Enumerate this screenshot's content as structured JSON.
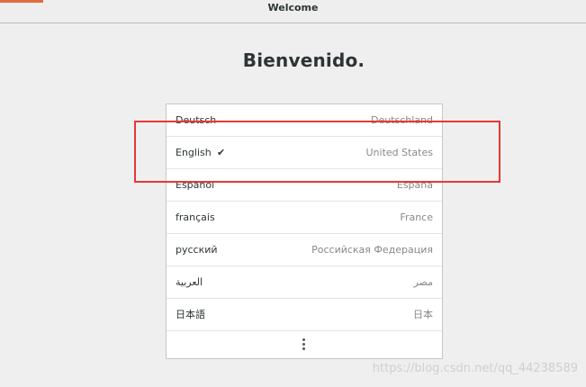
{
  "window": {
    "title": "Welcome"
  },
  "heading": "Bienvenido.",
  "languages": [
    {
      "name": "Deutsch",
      "country": "Deutschland",
      "selected": false
    },
    {
      "name": "English",
      "country": "United States",
      "selected": true
    },
    {
      "name": "Español",
      "country": "España",
      "selected": false
    },
    {
      "name": "français",
      "country": "France",
      "selected": false
    },
    {
      "name": "русский",
      "country": "Российская Федерация",
      "selected": false
    },
    {
      "name": "العربية",
      "country": "مصر",
      "selected": false
    },
    {
      "name": "日本語",
      "country": "日本",
      "selected": false
    }
  ],
  "selected_mark": "✔",
  "more_icon": "view-more-icon",
  "annotation": {
    "color": "#e53935"
  },
  "colors": {
    "accent": "#e06d3f",
    "background": "#efefef",
    "list_background": "#ffffff"
  },
  "watermark": "https://blog.csdn.net/qq_44238589"
}
